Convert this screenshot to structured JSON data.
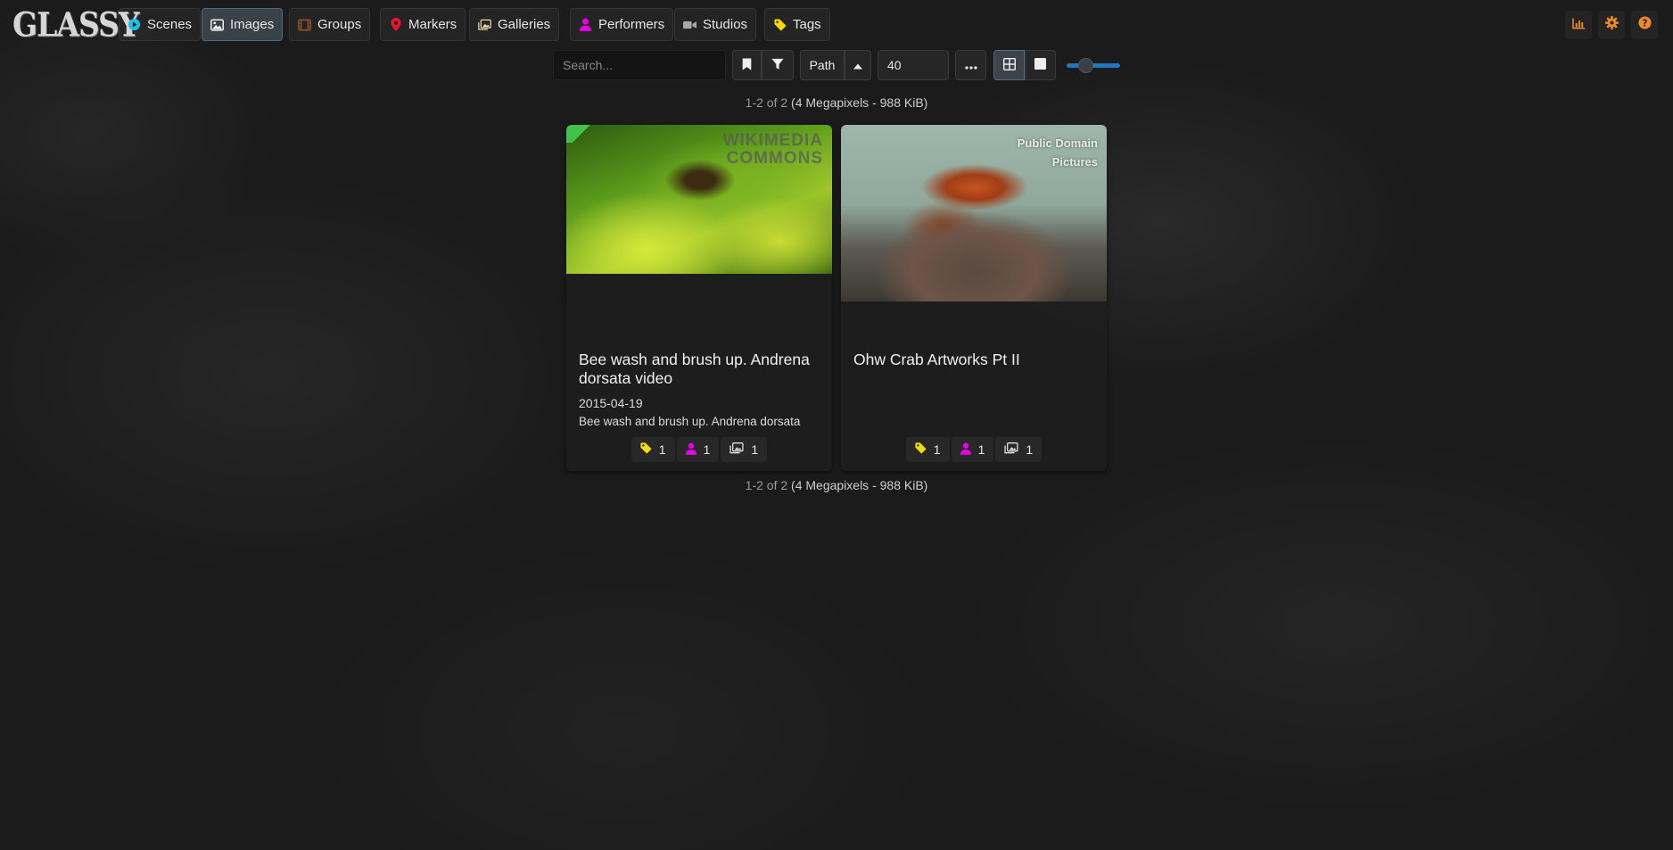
{
  "brand": "GLASSY",
  "nav": {
    "items": [
      {
        "label": "Scenes",
        "icon": "play-circle-icon"
      },
      {
        "label": "Images",
        "icon": "image-icon",
        "active": true
      },
      {
        "label": "Groups",
        "icon": "film-icon"
      },
      {
        "label": "Markers",
        "icon": "map-marker-icon"
      },
      {
        "label": "Galleries",
        "icon": "images-icon"
      },
      {
        "label": "Performers",
        "icon": "user-icon"
      },
      {
        "label": "Studios",
        "icon": "video-camera-icon"
      },
      {
        "label": "Tags",
        "icon": "tag-icon"
      }
    ],
    "right_icons": [
      "chart-icon",
      "gear-icon",
      "help-icon"
    ]
  },
  "toolbar": {
    "search_placeholder": "Search...",
    "sort_by": "Path",
    "per_page": "40",
    "zoom_level": 0.3,
    "more_label": "..."
  },
  "pagination": {
    "range": "1-2 of 2",
    "meta": "(4 Megapixels - 988 KiB)"
  },
  "cards": [
    {
      "title": "Bee wash and brush up. Andrena dorsata video",
      "date": "2015-04-19",
      "description": "Bee wash and brush up. Andrena dorsata",
      "watermark": "WIKIMEDIA\nCOMMONS",
      "counts": {
        "tags": "1",
        "performers": "1",
        "galleries": "1"
      }
    },
    {
      "title": "Ohw Crab Artworks Pt II",
      "date": "",
      "description": "",
      "watermark": "Public Domain\nPictures",
      "counts": {
        "tags": "1",
        "performers": "1",
        "galleries": "1"
      }
    }
  ],
  "colors": {
    "accent": "#1f78c1",
    "tag": "#f5d90a",
    "performer": "#e600e6",
    "nav_right": "#f08a24"
  }
}
